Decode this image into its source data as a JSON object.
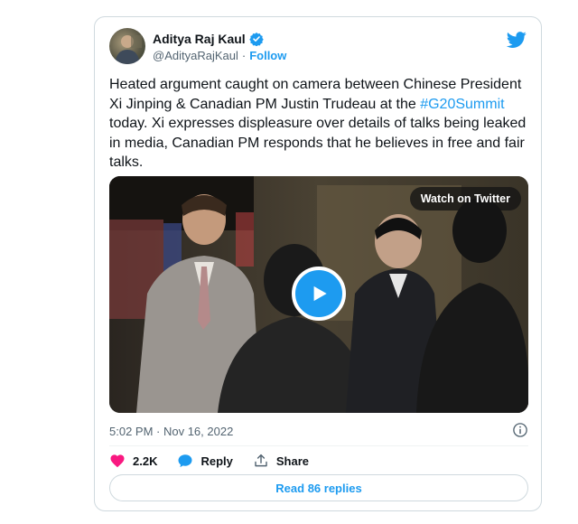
{
  "author": {
    "display_name": "Aditya Raj Kaul",
    "handle": "@AdityaRajKaul",
    "follow_label": "Follow"
  },
  "tweet": {
    "text_before": "Heated argument caught on camera between Chinese President Xi Jinping & Canadian PM Justin Trudeau at the ",
    "hashtag": "#G20Summit",
    "text_after": " today. Xi expresses displeasure over details of talks being leaked in media, Canadian PM responds that he believes in free and fair talks."
  },
  "media": {
    "watch_label": "Watch on Twitter"
  },
  "meta": {
    "timestamp": "5:02 PM · Nov 16, 2022"
  },
  "actions": {
    "like_count": "2.2K",
    "reply_label": "Reply",
    "share_label": "Share"
  },
  "read_replies_label": "Read 86 replies",
  "colors": {
    "accent": "#1d9bf0",
    "like": "#f91880",
    "text": "#0f1419",
    "muted": "#536471",
    "border": "#cfd9de"
  },
  "icons": [
    "verified-badge-icon",
    "twitter-bird-icon",
    "play-icon",
    "info-icon",
    "heart-icon",
    "reply-bubble-icon",
    "share-icon"
  ]
}
